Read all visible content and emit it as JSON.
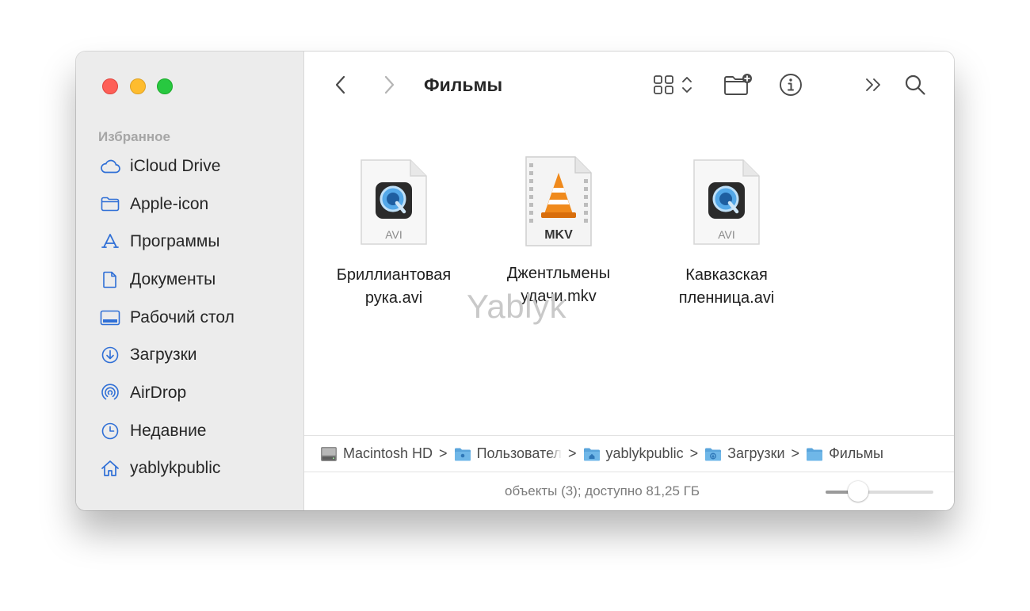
{
  "window": {
    "title": "Фильмы"
  },
  "sidebar": {
    "heading": "Избранное",
    "items": [
      {
        "label": "iCloud Drive",
        "icon": "cloud-icon"
      },
      {
        "label": "Apple-icon",
        "icon": "folder-icon"
      },
      {
        "label": "Программы",
        "icon": "applications-icon"
      },
      {
        "label": "Документы",
        "icon": "document-icon"
      },
      {
        "label": "Рабочий стол",
        "icon": "desktop-icon"
      },
      {
        "label": "Загрузки",
        "icon": "downloads-icon"
      },
      {
        "label": "AirDrop",
        "icon": "airdrop-icon"
      },
      {
        "label": "Недавние",
        "icon": "clock-icon"
      },
      {
        "label": "yablykpublic",
        "icon": "home-icon"
      }
    ]
  },
  "files": [
    {
      "name_line1": "Бриллиантовая",
      "name_line2": "рука.avi",
      "badge": "AVI",
      "icon": "quicktime-icon"
    },
    {
      "name_line1": "Джентльмены",
      "name_line2": "удачи.mkv",
      "badge": "MKV",
      "icon": "vlc-icon"
    },
    {
      "name_line1": "Кавказская",
      "name_line2": "пленница.avi",
      "badge": "AVI",
      "icon": "quicktime-icon"
    }
  ],
  "watermark": "Yablyk",
  "pathbar": [
    "Macintosh HD",
    "Пользовател",
    "yablykpublic",
    "Загрузки",
    "Фильмы"
  ],
  "pathbar_separator": ">",
  "status": "объекты (3); доступно 81,25 ГБ",
  "icon_size_slider": 0.3,
  "colors": {
    "accent": "#2f6fd6",
    "folder": "#5aa5dc",
    "close": "#fe5f57",
    "minimize": "#febc2e",
    "zoom": "#28c840",
    "vlc_orange": "#f08a1c"
  }
}
